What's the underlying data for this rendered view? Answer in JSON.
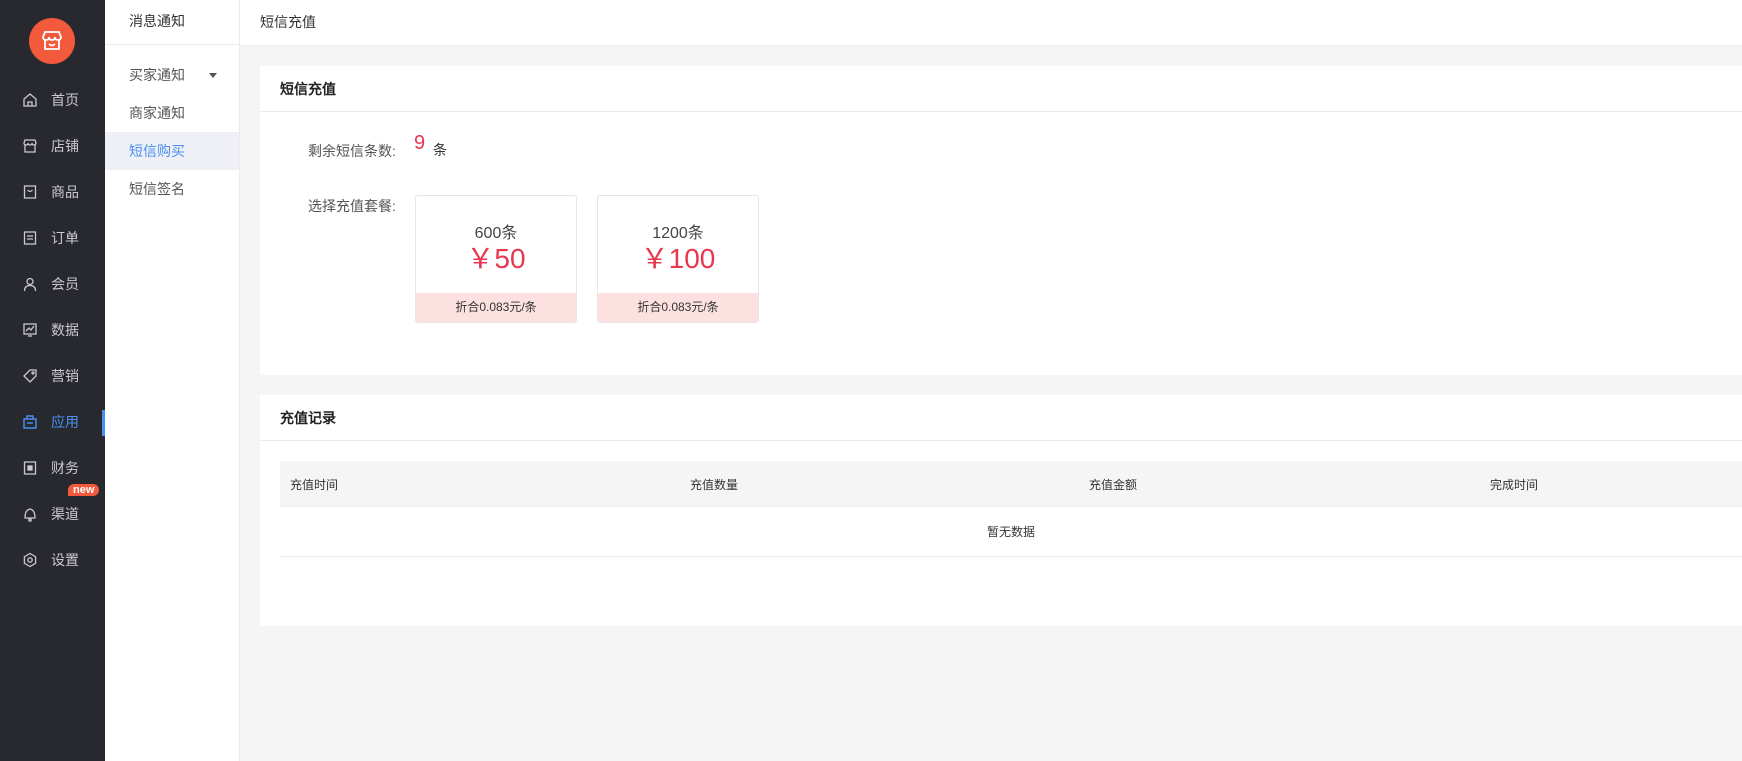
{
  "colors": {
    "accent": "#4a90f2",
    "price": "#e8364e",
    "logo": "#f25a3b",
    "nav_bg": "#28282f"
  },
  "nav": {
    "logo_icon": "store-icon",
    "items": [
      {
        "label": "首页",
        "icon": "home-icon"
      },
      {
        "label": "店铺",
        "icon": "shop-icon"
      },
      {
        "label": "商品",
        "icon": "goods-icon"
      },
      {
        "label": "订单",
        "icon": "order-icon"
      },
      {
        "label": "会员",
        "icon": "user-icon"
      },
      {
        "label": "数据",
        "icon": "chart-icon"
      },
      {
        "label": "营销",
        "icon": "tag-icon"
      },
      {
        "label": "应用",
        "icon": "app-icon",
        "active": true
      },
      {
        "label": "财务",
        "icon": "finance-icon"
      },
      {
        "label": "渠道",
        "icon": "channel-icon",
        "badge": "new"
      },
      {
        "label": "设置",
        "icon": "gear-icon"
      }
    ]
  },
  "subnav": {
    "title": "消息通知",
    "items": [
      {
        "label": "买家通知",
        "has_caret": true
      },
      {
        "label": "商家通知"
      },
      {
        "label": "短信购买",
        "active": true
      },
      {
        "label": "短信签名"
      }
    ]
  },
  "topbar": {
    "title": "短信充值"
  },
  "recharge": {
    "title": "短信充值",
    "remaining_label": "剩余短信条数:",
    "remaining_count": "9",
    "remaining_unit": "条",
    "package_label": "选择充值套餐:",
    "packages": [
      {
        "count": "600条",
        "price": "￥50",
        "unit_price": "折合0.083元/条"
      },
      {
        "count": "1200条",
        "price": "￥100",
        "unit_price": "折合0.083元/条"
      }
    ]
  },
  "records": {
    "title": "充值记录",
    "columns": [
      "充值时间",
      "充值数量",
      "充值金额",
      "完成时间"
    ],
    "empty_text": "暂无数据"
  }
}
